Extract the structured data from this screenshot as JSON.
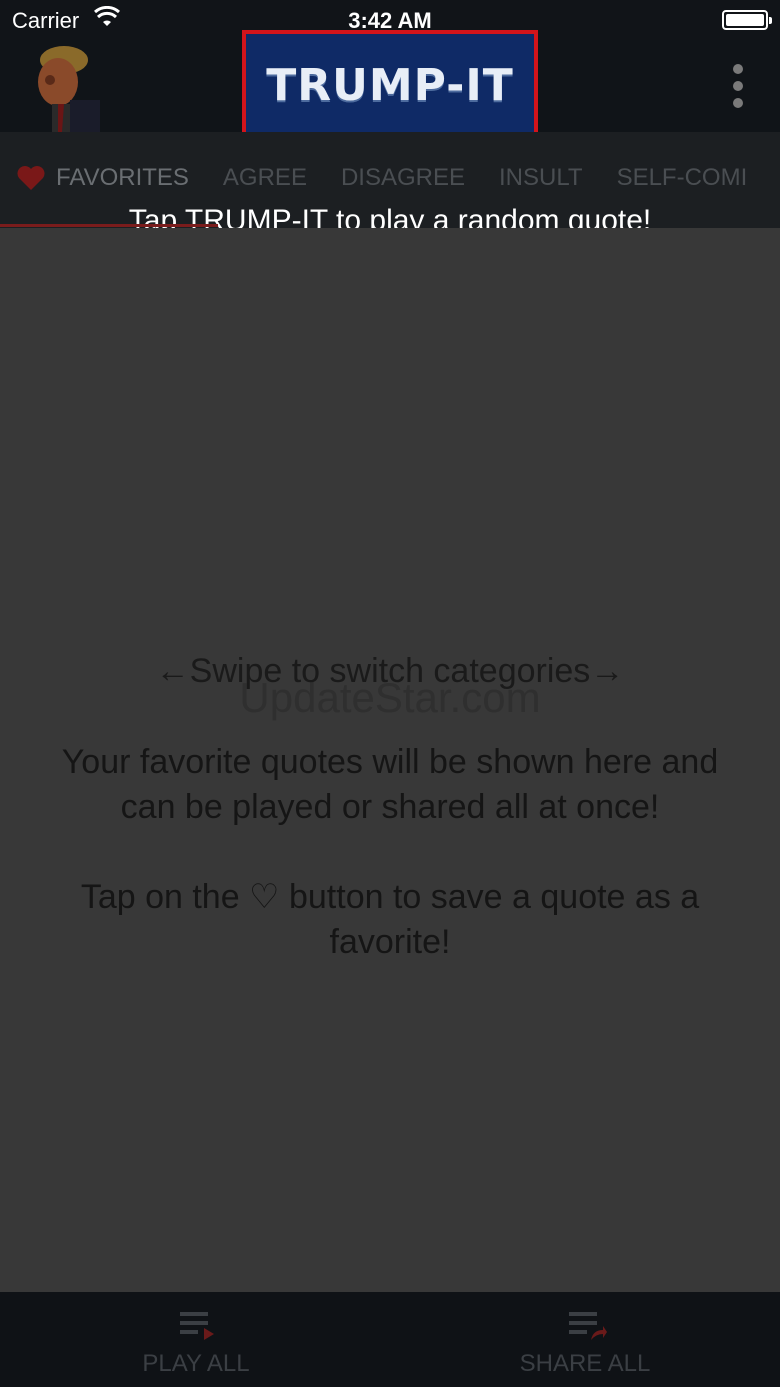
{
  "status_bar": {
    "carrier": "Carrier",
    "time": "3:42 AM"
  },
  "header": {
    "logo_text": "TRUMP-IT",
    "icons": [
      "avatar-icon",
      "more-vertical-icon"
    ]
  },
  "tabs": {
    "items": [
      {
        "label": "FAVORITES",
        "icon": "heart-icon"
      },
      {
        "label": "AGREE"
      },
      {
        "label": "DISAGREE"
      },
      {
        "label": "INSULT"
      },
      {
        "label": "SELF-COMI"
      }
    ],
    "hint": "Tap TRUMP-IT to play a random quote!"
  },
  "content": {
    "swipe_hint": "←Swipe to switch categories→",
    "watermark": "UpdateStar.com",
    "message_1": "Your favorite quotes will be shown here and can be played or shared all at once!",
    "message_2": "Tap on the ♡ button to save a quote as a favorite!"
  },
  "bottom_bar": {
    "play_all": "PLAY ALL",
    "share_all": "SHARE ALL"
  },
  "colors": {
    "logo_border": "#d3141b",
    "logo_bg": "#0f2a66",
    "background": "#383838"
  }
}
